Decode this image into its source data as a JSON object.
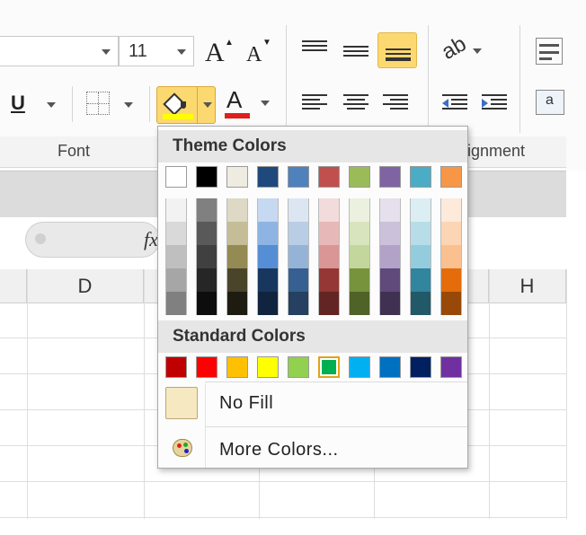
{
  "ribbon": {
    "font_size": "11",
    "grow_font_label": "A",
    "shrink_font_label": "A",
    "underline_label": "U",
    "font_color_label": "A",
    "font_group_label": "Font",
    "alignment_group_label": "ignment",
    "wrap_text_label": "a",
    "colors": {
      "highlight": "#fbd970",
      "font_color_bar": "#e0201b",
      "fill_icon_bucket": "#ffff00"
    }
  },
  "formula": {
    "fx_label": "fx"
  },
  "columns": {
    "d": "D",
    "h": "H"
  },
  "dropdown": {
    "theme_colors_label": "Theme Colors",
    "standard_colors_label": "Standard Colors",
    "no_fill_label": "No Fill",
    "more_colors_label": "More Colors...",
    "theme_colors": [
      {
        "name": "white",
        "base": "#ffffff",
        "shades": [
          "#f2f2f2",
          "#d9d9d9",
          "#bfbfbf",
          "#a6a6a6",
          "#808080"
        ]
      },
      {
        "name": "black",
        "base": "#000000",
        "shades": [
          "#808080",
          "#595959",
          "#404040",
          "#262626",
          "#0d0d0d"
        ]
      },
      {
        "name": "tan",
        "base": "#eeece1",
        "shades": [
          "#ddd9c4",
          "#c4bd97",
          "#948a54",
          "#4a452a",
          "#1e1c11"
        ]
      },
      {
        "name": "dark-blue",
        "base": "#1f497d",
        "shades": [
          "#c6d9f1",
          "#8eb4e3",
          "#558ed5",
          "#17375e",
          "#10243f"
        ]
      },
      {
        "name": "blue",
        "base": "#4f81bd",
        "shades": [
          "#dce6f2",
          "#b9cde5",
          "#95b3d7",
          "#376092",
          "#254061"
        ]
      },
      {
        "name": "red",
        "base": "#c0504d",
        "shades": [
          "#f2dcdb",
          "#e6b9b8",
          "#d99694",
          "#953735",
          "#632523"
        ]
      },
      {
        "name": "olive-green",
        "base": "#9bbb59",
        "shades": [
          "#ebf1de",
          "#d7e4bd",
          "#c3d69b",
          "#77933c",
          "#4f6228"
        ]
      },
      {
        "name": "purple",
        "base": "#8064a2",
        "shades": [
          "#e6e0ec",
          "#ccc1da",
          "#b3a2c7",
          "#604a7b",
          "#403152"
        ]
      },
      {
        "name": "aqua",
        "base": "#4bacc6",
        "shades": [
          "#dbeef4",
          "#b7dee8",
          "#93cddd",
          "#31859c",
          "#215968"
        ]
      },
      {
        "name": "orange",
        "base": "#f79646",
        "shades": [
          "#fdeada",
          "#fcd5b5",
          "#fac090",
          "#e46c0a",
          "#984807"
        ]
      }
    ],
    "standard_colors": [
      "#c00000",
      "#ff0000",
      "#ffc000",
      "#ffff00",
      "#92d050",
      "#00b050",
      "#00b0f0",
      "#0070c0",
      "#002060",
      "#7030a0"
    ],
    "selected_standard_index": 5,
    "no_fill_swatch_color": "#f6e8c0"
  }
}
